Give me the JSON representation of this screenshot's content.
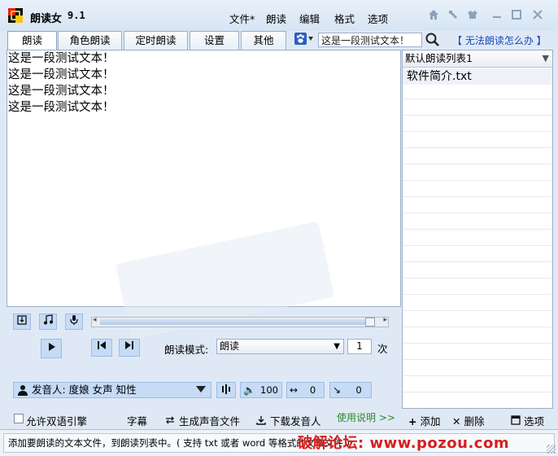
{
  "app": {
    "name": "朗读女",
    "version": "9.1"
  },
  "menu": [
    "文件*",
    "朗读",
    "编辑",
    "格式",
    "选项"
  ],
  "tabs": [
    "朗读",
    "角色朗读",
    "定时朗读",
    "设置",
    "其他"
  ],
  "search": {
    "value": "这是一段测试文本！"
  },
  "help_link": "【 无法朗读怎么办 】",
  "text_lines": [
    "这是一段测试文本！",
    "这是一段测试文本！",
    "这是一段测试文本！",
    "这是一段测试文本！"
  ],
  "playlist": {
    "selected": "默认朗读列表1",
    "items": [
      "软件简介.txt"
    ]
  },
  "mode": {
    "label": "朗读模式:",
    "value": "朗读",
    "count": "1",
    "unit": "次"
  },
  "voice": {
    "label": "发音人: 度娘 女声 知性",
    "volume": "100",
    "speed": "0",
    "pitch": "0"
  },
  "bottom": {
    "bilingual": "允许双语引擎",
    "subtitles": "字幕",
    "generate_audio": "生成声音文件",
    "download_voice": "下载发音人",
    "instructions": "使用说明 >>",
    "add": "添加",
    "delete": "删除",
    "options": "选项"
  },
  "status_text": "添加要朗读的文本文件，到朗读列表中。( 支持 txt 或者 word 等格式的文本文件 )",
  "forum_watermark": "破解论坛: www.pozou.com",
  "colors": {
    "accent": "#c5dbf6",
    "link": "#1847b8",
    "watermark": "#d61f1f"
  }
}
